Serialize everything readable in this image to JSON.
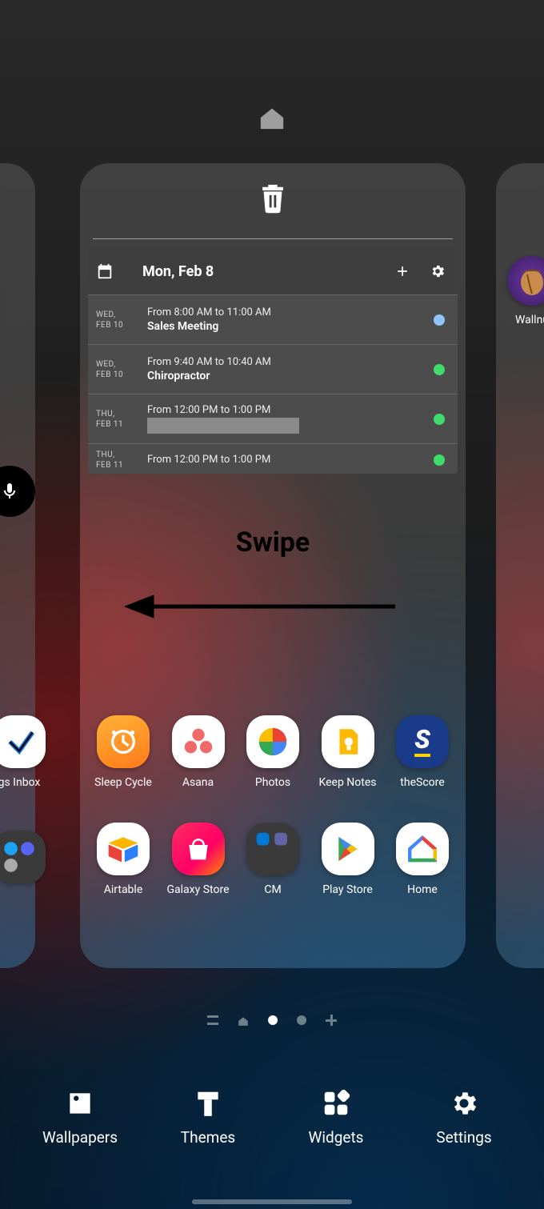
{
  "annotation": {
    "swipe_label": "Swipe"
  },
  "home_indicator": "home",
  "calendar_widget": {
    "title": "Mon, Feb 8",
    "events": [
      {
        "day": "WED,",
        "date": "FEB 10",
        "time": "From 8:00 AM to 11:00 AM",
        "name": "Sales Meeting",
        "dot": "#8ec5ff"
      },
      {
        "day": "WED,",
        "date": "FEB 10",
        "time": "From 9:40 AM to 10:40 AM",
        "name": "Chiropractor",
        "dot": "#3fdc6a"
      },
      {
        "day": "THU,",
        "date": "FEB 11",
        "time": "From 12:00 PM to 1:00 PM",
        "name": "",
        "redacted": true,
        "dot": "#3fdc6a"
      },
      {
        "day": "THU,",
        "date": "FEB 11",
        "time": "From 12:00 PM to 1:00 PM",
        "name": "",
        "dot": "#3fdc6a"
      }
    ]
  },
  "main_panel_apps_row1": [
    {
      "label": "Sleep Cycle"
    },
    {
      "label": "Asana"
    },
    {
      "label": "Photos"
    },
    {
      "label": "Keep Notes"
    },
    {
      "label": "theScore"
    }
  ],
  "main_panel_apps_row2": [
    {
      "label": "Airtable"
    },
    {
      "label": "Galaxy Store"
    },
    {
      "label": "CM"
    },
    {
      "label": "Play Store"
    },
    {
      "label": "Home"
    }
  ],
  "left_panel": {
    "partial_app_top": "gs Inbox"
  },
  "right_panel": {
    "partial_app": "Wallnu"
  },
  "bottom_bar": [
    {
      "label": "Wallpapers"
    },
    {
      "label": "Themes"
    },
    {
      "label": "Widgets"
    },
    {
      "label": "Settings"
    }
  ]
}
